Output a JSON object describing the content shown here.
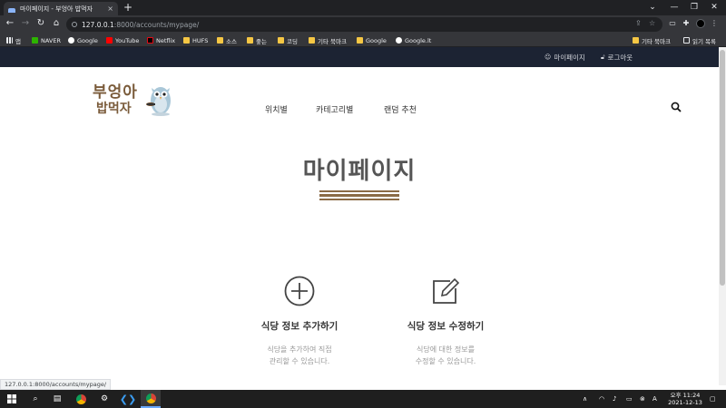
{
  "browser": {
    "tab_title": "마이페이지 - 부엉아 밥먹자",
    "tab_close": "×",
    "new_tab": "+",
    "url_host": "127.0.0.1",
    "url_path": ":8000/accounts/mypage/",
    "window_controls": [
      "⌄",
      "—",
      "❐",
      "✕"
    ],
    "status_url": "127.0.0.1:8000/accounts/mypage/"
  },
  "bookmarks": {
    "items": [
      {
        "label": "앱",
        "icon": "apps-icon"
      },
      {
        "label": "NAVER",
        "icon": "naver-icon"
      },
      {
        "label": "Google",
        "icon": "google-icon"
      },
      {
        "label": "YouTube",
        "icon": "youtube-icon"
      },
      {
        "label": "Netflix",
        "icon": "netflix-icon"
      },
      {
        "label": "HUFS",
        "icon": "folder-icon"
      },
      {
        "label": "소스",
        "icon": "folder-icon"
      },
      {
        "label": "좋는",
        "icon": "folder-icon"
      },
      {
        "label": "코딩",
        "icon": "folder-icon"
      },
      {
        "label": "기타 북마크",
        "icon": "folder-icon"
      },
      {
        "label": "Google",
        "icon": "folder-icon"
      },
      {
        "label": "Google.lt",
        "icon": "google-icon"
      }
    ],
    "right": [
      {
        "label": "기타 북마크",
        "icon": "folder-icon"
      },
      {
        "label": "읽기 목록",
        "icon": "reading-list-icon"
      }
    ]
  },
  "site": {
    "top_links": {
      "mypage": "마이페이지",
      "logout": "로그아웃"
    },
    "logo_line1": "부엉아",
    "logo_line2": "밥먹자",
    "nav": [
      "위치별",
      "카테고리별",
      "랜덤 추천"
    ],
    "page_title": "마이페이지",
    "accent_color": "#8b6b46",
    "cards": [
      {
        "title": "식당 정보 추가하기",
        "desc_line1": "식당을 추가하여 직접",
        "desc_line2": "관리할 수 있습니다.",
        "icon": "plus-circle-icon"
      },
      {
        "title": "식당 정보 수정하기",
        "desc_line1": "식당에 대한 정보를",
        "desc_line2": "수정할 수 있습니다.",
        "icon": "edit-icon"
      }
    ]
  },
  "taskbar": {
    "time": "오후 11:24",
    "date": "2021-12-13"
  }
}
